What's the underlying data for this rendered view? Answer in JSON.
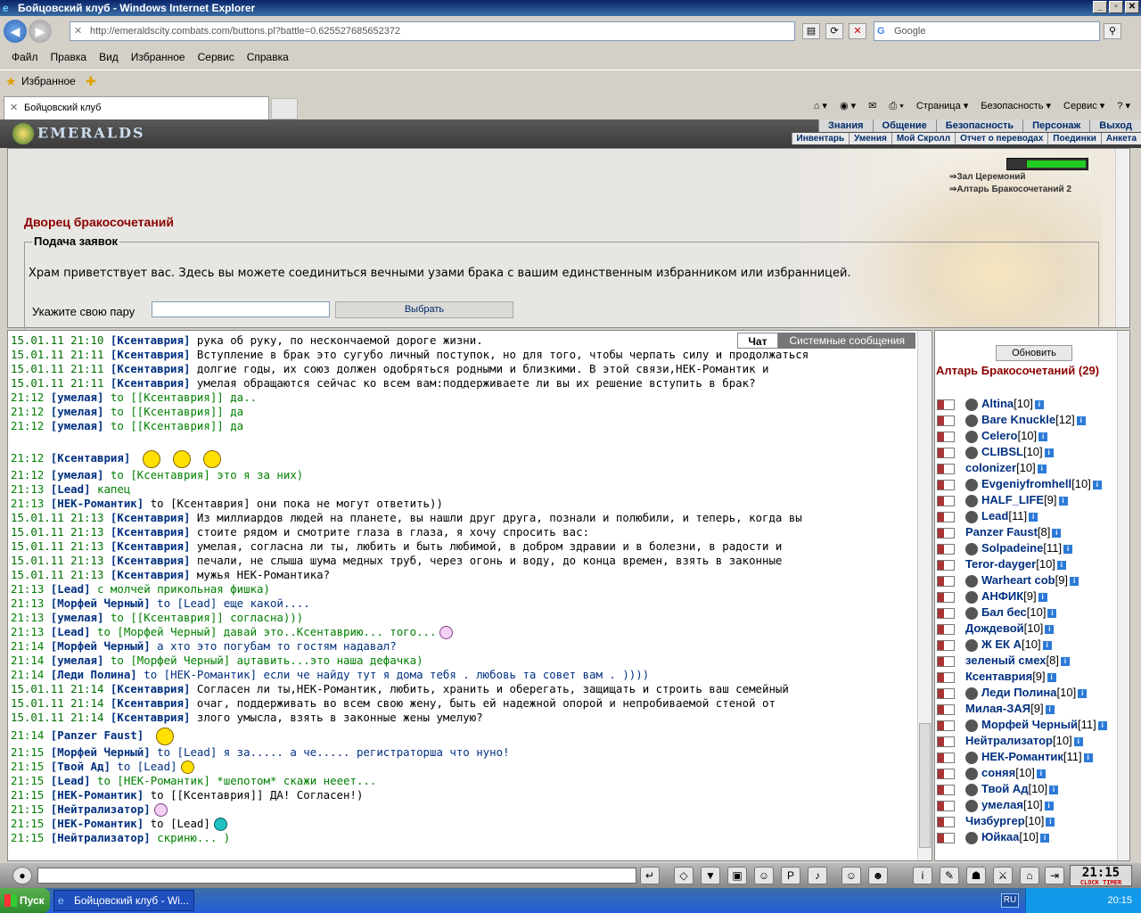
{
  "window": {
    "title": "Бойцовский клуб - Windows Internet Explorer"
  },
  "browser": {
    "url": "http://emeraldscity.combats.com/buttons.pl?battle=0.625527685652372",
    "search_placeholder": "Google",
    "menu": [
      "Файл",
      "Правка",
      "Вид",
      "Избранное",
      "Сервис",
      "Справка"
    ],
    "favorites_label": "Избранное",
    "tab_title": "Бойцовский клуб",
    "commands": [
      "Страница",
      "Безопасность",
      "Сервис"
    ]
  },
  "game": {
    "logo": "EMERALDS",
    "top_nav": [
      "Знания",
      "Общение",
      "Безопасность",
      "Персонаж",
      "Выход"
    ],
    "sub_nav": [
      "Инвентарь",
      "Умения",
      "Мой Скролл",
      "Отчет о переводах",
      "Поединки",
      "Анкета"
    ],
    "locations": [
      "Зал Церемоний",
      "Алтарь Бракосочетаний 2"
    ],
    "page_title": "Дворец бракосочетаний",
    "section_title": "Подача заявок",
    "greeting": "Храм приветствует вас. Здесь вы можете соединиться вечными узами брака с вашим единственным избранником или избранницей.",
    "pair_label": "Укажите свою пару",
    "select_button": "Выбрать"
  },
  "chat": {
    "tabs": [
      "Чат",
      "Системные сообщения"
    ],
    "lines": [
      {
        "ts": "15.01.11 21:10",
        "nick": "[Ксентаврия]",
        "text": "рука об руку, по нескончаемой дороге жизни.",
        "c": "n"
      },
      {
        "ts": "15.01.11 21:11",
        "nick": "[Ксентаврия]",
        "text": "Вступление в брак это сугубо личный поступок, но для того, чтобы черпать силу и продолжаться",
        "c": "n"
      },
      {
        "ts": "15.01.11 21:11",
        "nick": "[Ксентаврия]",
        "text": "долгие годы, их союз должен одобряться родными и близкими. В этой связи,НЕК-Романтик и",
        "c": "n"
      },
      {
        "ts": "15.01.11 21:11",
        "nick": "[Ксентаврия]",
        "text": "умелая обращаются сейчас ко всем вам:поддерживаете ли вы их решение вступить в брак?",
        "c": "n"
      },
      {
        "ts": "21:12",
        "nick": "[умелая]",
        "text": "to [[Ксентаврия]] да..",
        "c": "g"
      },
      {
        "ts": "21:12",
        "nick": "[умелая]",
        "text": "to [[Ксентаврия]] да",
        "c": "g"
      },
      {
        "ts": "21:12",
        "nick": "[умелая]",
        "text": "to [[Ксентаврия]] да",
        "c": "g"
      },
      {
        "ts": "",
        "nick": "",
        "text": "",
        "c": "n",
        "blank": true
      },
      {
        "ts": "21:12",
        "nick": "[Ксентаврия]",
        "text": "",
        "c": "n",
        "smiles": 3,
        "tall": true
      },
      {
        "ts": "21:12",
        "nick": "[умелая]",
        "text": "to [Ксентаврия] это я за них)",
        "c": "g"
      },
      {
        "ts": "21:13",
        "nick": "[Lead]",
        "text": "капец",
        "c": "g"
      },
      {
        "ts": "21:13",
        "nick": "[НЕК-Романтик]",
        "text": "to [Ксентаврия] они пока не могут ответить))",
        "c": "n"
      },
      {
        "ts": "15.01.11 21:13",
        "nick": "[Ксентаврия]",
        "text": "Из миллиардов людей на планете, вы нашли друг друга, познали и полюбили, и теперь, когда вы",
        "c": "n"
      },
      {
        "ts": "15.01.11 21:13",
        "nick": "[Ксентаврия]",
        "text": "стоите рядом и смотрите глаза в глаза, я хочу спросить вас:",
        "c": "n"
      },
      {
        "ts": "15.01.11 21:13",
        "nick": "[Ксентаврия]",
        "text": "умелая, согласна ли ты, любить и быть любимой, в добром здравии и в болезни, в радости и",
        "c": "n"
      },
      {
        "ts": "15.01.11 21:13",
        "nick": "[Ксентаврия]",
        "text": "печали, не слыша шума медных труб, через огонь и воду, до конца времен, взять в законные",
        "c": "n"
      },
      {
        "ts": "15.01.11 21:13",
        "nick": "[Ксентаврия]",
        "text": "мужья НЕК-Романтика?",
        "c": "n"
      },
      {
        "ts": "21:13",
        "nick": "[Lead]",
        "text": "с молчей прикольная фишка)",
        "c": "g"
      },
      {
        "ts": "21:13",
        "nick": "[Морфей Черный]",
        "text": "to [Lead] еще какой....",
        "c": "b"
      },
      {
        "ts": "21:13",
        "nick": "[умелая]",
        "text": "to [[Ксентаврия]] согласна)))",
        "c": "g"
      },
      {
        "ts": "21:13",
        "nick": "[Lead]",
        "text": "to [Морфей Черный] давай это..Ксентаврию... того...",
        "c": "g",
        "smiles": 1,
        "sc": "p"
      },
      {
        "ts": "21:14",
        "nick": "[Морфей Черный]",
        "text": "а хто это погубам то гостям надавал?",
        "c": "b"
      },
      {
        "ts": "21:14",
        "nick": "[умелая]",
        "text": "to [Морфей Черный] аџтавить...это наша дефачка)",
        "c": "g"
      },
      {
        "ts": "21:14",
        "nick": "[Леди Полина]",
        "text": "to [НЕК-Романтик] если че найду тут я дома тебя . любовь та совет вам . ))))",
        "c": "b"
      },
      {
        "ts": "15.01.11 21:14",
        "nick": "[Ксентаврия]",
        "text": "Согласен ли ты,НЕК-Романтик, любить, хранить и оберегать, защищать и строить ваш семейный",
        "c": "n"
      },
      {
        "ts": "15.01.11 21:14",
        "nick": "[Ксентаврия]",
        "text": "очаг, поддерживать во всем свою жену, быть ей надежной опорой и непробиваемой стеной от",
        "c": "n"
      },
      {
        "ts": "15.01.11 21:14",
        "nick": "[Ксентаврия]",
        "text": "злого умысла, взять в законные жены умелую?",
        "c": "n"
      },
      {
        "ts": "21:14",
        "nick": "[Panzer Faust]",
        "text": "",
        "c": "n",
        "smiles": 1,
        "tall": true
      },
      {
        "ts": "21:15",
        "nick": "[Морфей Черный]",
        "text": "to [Lead] я за..... а че..... регистраторша что нуно!",
        "c": "b"
      },
      {
        "ts": "21:15",
        "nick": "[Твой Ад]",
        "text": "to [Lead]",
        "c": "b",
        "smiles": 1
      },
      {
        "ts": "21:15",
        "nick": "[Lead]",
        "text": "to [НЕК-Романтик] *шепотом* скажи нееет...",
        "c": "g"
      },
      {
        "ts": "21:15",
        "nick": "[НЕК-Романтик]",
        "text": "to [[Ксентаврия]] ДА! Согласен!)",
        "c": "n"
      },
      {
        "ts": "21:15",
        "nick": "[Нейтрализатор]",
        "text": "",
        "c": "n",
        "smiles": 1,
        "sc": "p"
      },
      {
        "ts": "21:15",
        "nick": "[НЕК-Романтик]",
        "text": "to [Lead]",
        "c": "n",
        "smiles": 1,
        "sc": "t"
      },
      {
        "ts": "21:15",
        "nick": "[Нейтрализатор]",
        "text": "скриню... )",
        "c": "g"
      }
    ]
  },
  "users": {
    "refresh_button": "Обновить",
    "room_title": "Алтарь Бракосочетаний (29)",
    "list": [
      {
        "name": "Altina",
        "lvl": "[10]",
        "av": true
      },
      {
        "name": "Bare Knuckle",
        "lvl": "[12]",
        "av": true
      },
      {
        "name": "Celero",
        "lvl": "[10]",
        "av": true
      },
      {
        "name": "CLIBSL",
        "lvl": "[10]",
        "av": true
      },
      {
        "name": "colonizer",
        "lvl": "[10]",
        "av": false
      },
      {
        "name": "Evgeniyfromhell",
        "lvl": "[10]",
        "av": true
      },
      {
        "name": "HALF_LIFE",
        "lvl": "[9]",
        "av": true
      },
      {
        "name": "Lead",
        "lvl": "[11]",
        "av": true
      },
      {
        "name": "Panzer Faust",
        "lvl": "[8]",
        "av": false
      },
      {
        "name": "Solpadeine",
        "lvl": "[11]",
        "av": true
      },
      {
        "name": "Teror-dayger",
        "lvl": "[10]",
        "av": false
      },
      {
        "name": "Warheart cob",
        "lvl": "[9]",
        "av": true
      },
      {
        "name": "АНФИК",
        "lvl": "[9]",
        "av": true
      },
      {
        "name": "Бал бес",
        "lvl": "[10]",
        "av": true
      },
      {
        "name": "Дождевой",
        "lvl": "[10]",
        "av": false
      },
      {
        "name": "Ж ЕК А",
        "lvl": "[10]",
        "av": true
      },
      {
        "name": "зеленый смех",
        "lvl": "[8]",
        "av": false
      },
      {
        "name": "Ксентаврия",
        "lvl": "[9]",
        "av": false
      },
      {
        "name": "Леди Полина",
        "lvl": "[10]",
        "av": true
      },
      {
        "name": "Милая-ЗАЯ",
        "lvl": "[9]",
        "av": false
      },
      {
        "name": "Морфей Черный",
        "lvl": "[11]",
        "av": true
      },
      {
        "name": "Нейтрализатор",
        "lvl": "[10]",
        "av": false
      },
      {
        "name": "НЕК-Романтик",
        "lvl": "[11]",
        "av": true
      },
      {
        "name": "соняя",
        "lvl": "[10]",
        "av": true
      },
      {
        "name": "Твой Ад",
        "lvl": "[10]",
        "av": true
      },
      {
        "name": "умелая",
        "lvl": "[10]",
        "av": true
      },
      {
        "name": "Чизбургер",
        "lvl": "[10]",
        "av": false
      },
      {
        "name": "Юйкаа",
        "lvl": "[10]",
        "av": true
      }
    ]
  },
  "bottom": {
    "clock": "21:15",
    "clock_label": "CLOCK TIMER"
  },
  "taskbar": {
    "start": "Пуск",
    "task": "Бойцовский клуб - Wi...",
    "lang": "RU",
    "time": "20:15"
  }
}
